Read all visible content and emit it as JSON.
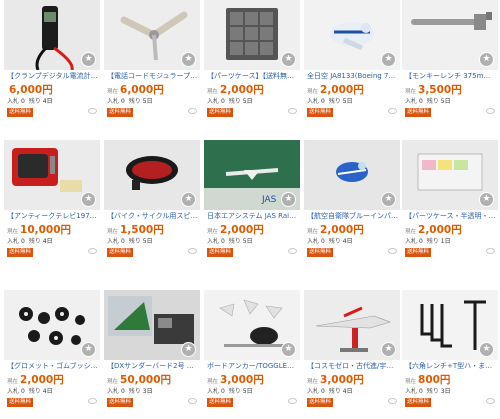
{
  "labels": {
    "start_price": "現在",
    "bids": "入札",
    "remaining": "残り",
    "free_shipping": "送料無料"
  },
  "items": [
    {
      "title": "【クランプデジタル電流計テス…",
      "price": "6,000円",
      "bids": "0",
      "remaining": "4日",
      "image": "clamp-meter",
      "price_label": ""
    },
    {
      "title": "【電話コードモジュラープラグ…",
      "price": "6,000円",
      "bids": "0",
      "remaining": "5日",
      "image": "crimp-tool",
      "price_label": "現在"
    },
    {
      "title": "【パーツケース】【送料無料】…",
      "price": "2,000円",
      "bids": "0",
      "remaining": "5日",
      "image": "parts-case",
      "price_label": "現在"
    },
    {
      "title": "全日空 JA8133(Boeing 747…",
      "price": "2,000円",
      "bids": "0",
      "remaining": "5日",
      "image": "airplane-model",
      "price_label": "現在"
    },
    {
      "title": "【モンキーレンチ 375mm/工…",
      "price": "3,500円",
      "bids": "0",
      "remaining": "5日",
      "image": "wrench",
      "price_label": "現在"
    },
    {
      "title": "【アンティークテレビ1976年…",
      "price": "10,000円",
      "bids": "0",
      "remaining": "4日",
      "image": "red-tv",
      "price_label": "現在"
    },
    {
      "title": "【バイク・サイクル用スピーカ…",
      "price": "1,500円",
      "bids": "0",
      "remaining": "5日",
      "image": "bike-speaker",
      "price_label": "現在"
    },
    {
      "title": "日本エアシステム JAS Raim…",
      "price": "2,000円",
      "bids": "0",
      "remaining": "5日",
      "image": "jas-model",
      "price_label": "現在"
    },
    {
      "title": "【航空自衛隊ブルーインパルス…",
      "price": "2,000円",
      "bids": "0",
      "remaining": "4日",
      "image": "blue-impulse",
      "price_label": "現在"
    },
    {
      "title": "【パーツケース・半透明・16…",
      "price": "2,000円",
      "bids": "0",
      "remaining": "1日",
      "image": "clear-case",
      "price_label": "現在"
    },
    {
      "title": "【グロメット・ゴムブッシング…",
      "price": "2,000円",
      "bids": "0",
      "remaining": "4日",
      "image": "grommets",
      "price_label": "現在"
    },
    {
      "title": "【DXサンダーバード2号 THU…",
      "price": "50,000円",
      "bids": "0",
      "remaining": "3日",
      "image": "thunderbird",
      "price_label": "現在"
    },
    {
      "title": "ボードアンカー/TOGGLERト…",
      "price": "3,000円",
      "bids": "0",
      "remaining": "5日",
      "image": "anchors",
      "price_label": "現在"
    },
    {
      "title": "【コスモゼロ・古代進/宇宙戦…",
      "price": "3,000円",
      "bids": "0",
      "remaining": "4日",
      "image": "cosmo-zero",
      "price_label": "現在"
    },
    {
      "title": "【六角レンチ+T型ハ・まとめ…",
      "price": "800円",
      "bids": "0",
      "remaining": "3日",
      "image": "hex-keys",
      "price_label": "現在"
    }
  ]
}
